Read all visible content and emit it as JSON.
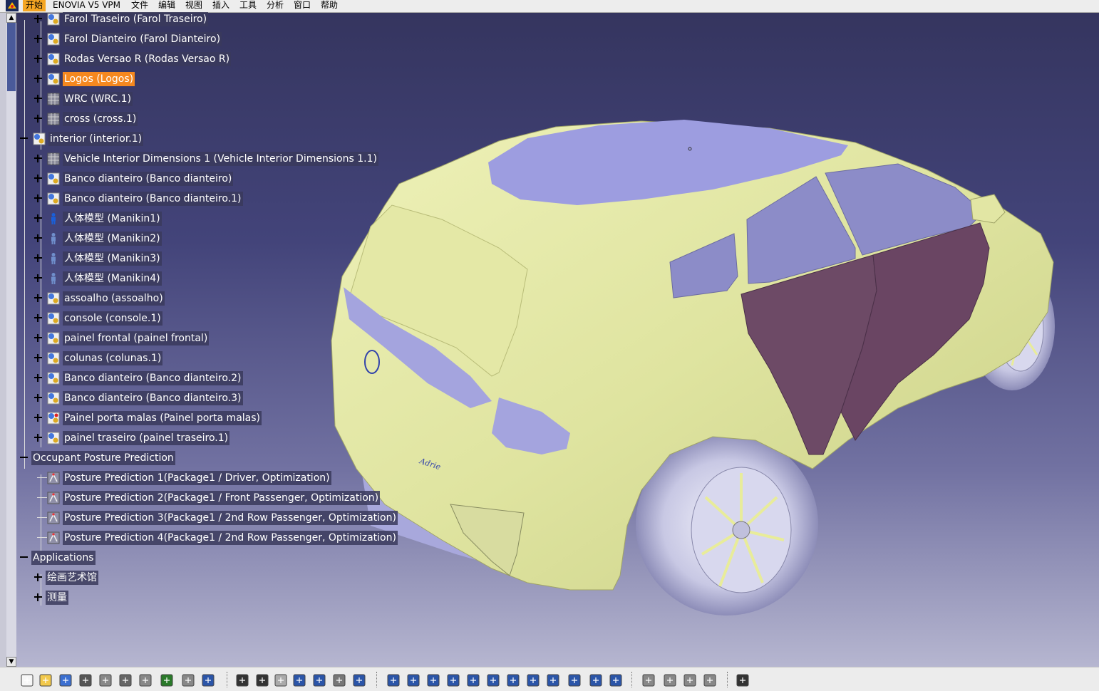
{
  "menubar": {
    "items": [
      "开始",
      "ENOVIA V5 VPM",
      "文件",
      "编辑",
      "视图",
      "插入",
      "工具",
      "分析",
      "窗口",
      "帮助"
    ]
  },
  "tree": {
    "nodes": [
      {
        "label": "Farol Traseiro (Farol Traseiro)",
        "kind": "part"
      },
      {
        "label": "Farol Dianteiro (Farol Dianteiro)",
        "kind": "part"
      },
      {
        "label": "Rodas Versao R (Rodas Versao R)",
        "kind": "part"
      },
      {
        "label": "Logos (Logos)",
        "kind": "part",
        "selected": true
      },
      {
        "label": "WRC (WRC.1)",
        "kind": "mesh"
      },
      {
        "label": "cross (cross.1)",
        "kind": "mesh"
      },
      {
        "label": "interior (interior.1)",
        "kind": "product"
      },
      {
        "label": "Vehicle Interior Dimensions 1 (Vehicle Interior Dimensions 1.1)",
        "kind": "mesh"
      },
      {
        "label": "Banco dianteiro (Banco dianteiro)",
        "kind": "part"
      },
      {
        "label": "Banco dianteiro (Banco dianteiro.1)",
        "kind": "part"
      },
      {
        "label": "人体模型 (Manikin1)",
        "kind": "manikin"
      },
      {
        "label": "人体模型 (Manikin2)",
        "kind": "manikin-light"
      },
      {
        "label": "人体模型 (Manikin3)",
        "kind": "manikin-light"
      },
      {
        "label": "人体模型 (Manikin4)",
        "kind": "manikin-light"
      },
      {
        "label": "assoalho (assoalho)",
        "kind": "part"
      },
      {
        "label": "console (console.1)",
        "kind": "part"
      },
      {
        "label": "painel frontal (painel frontal)",
        "kind": "part"
      },
      {
        "label": "colunas (colunas.1)",
        "kind": "part"
      },
      {
        "label": "Banco dianteiro (Banco dianteiro.2)",
        "kind": "part"
      },
      {
        "label": "Banco dianteiro (Banco dianteiro.3)",
        "kind": "part"
      },
      {
        "label": "Painel porta malas (Painel porta malas)",
        "kind": "part-red"
      },
      {
        "label": "painel traseiro (painel traseiro.1)",
        "kind": "part"
      },
      {
        "label": "Occupant Posture Prediction",
        "kind": "none"
      },
      {
        "label": "Posture Prediction 1(Package1 / Driver, Optimization)",
        "kind": "posture"
      },
      {
        "label": "Posture Prediction 2(Package1 / Front Passenger, Optimization)",
        "kind": "posture"
      },
      {
        "label": "Posture Prediction 3(Package1 / 2nd Row Passenger, Optimization)",
        "kind": "posture"
      },
      {
        "label": "Posture Prediction 4(Package1 / 2nd Row Passenger, Optimization)",
        "kind": "posture"
      },
      {
        "label": "Applications",
        "kind": "none"
      },
      {
        "label": "绘画艺术馆",
        "kind": "none"
      },
      {
        "label": "测量",
        "kind": "none"
      }
    ]
  },
  "viewport": {
    "colors": {
      "body": "#e2e6a4",
      "glass": "#9a9ad8",
      "door": "#6b4763",
      "wheel": "#c4c4e0",
      "background_top": "#35355f"
    }
  },
  "toolbar": {
    "icons": [
      "new-icon",
      "open-icon",
      "save-icon",
      "print-icon",
      "cut-icon",
      "copy-icon",
      "paste-icon",
      "undo-icon",
      "redo-icon",
      "whats-this-icon",
      "formula-icon",
      "comment-icon",
      "light-icon",
      "table-icon",
      "tree-expand-icon",
      "lock-icon",
      "catalog-icon",
      "fly-mode-icon",
      "fit-all-icon",
      "pan-icon",
      "rotate-icon",
      "zoom-in-icon",
      "zoom-out-icon",
      "normal-view-icon",
      "multi-view-icon",
      "iso-view-icon",
      "shading-icon",
      "hide-show-icon",
      "swap-space-icon",
      "manipulation-icon",
      "snap-icon",
      "explode-icon",
      "clash-icon",
      "capture-icon"
    ]
  }
}
